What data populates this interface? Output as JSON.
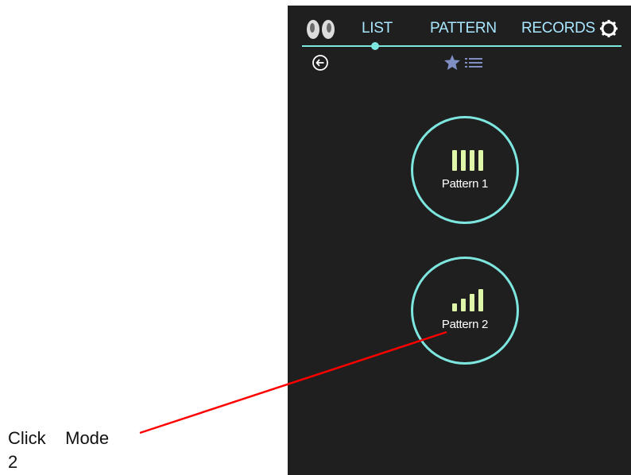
{
  "nav": {
    "tabs": [
      {
        "label": "LIST"
      },
      {
        "label": "PATTERN"
      },
      {
        "label": "RECORDS"
      }
    ],
    "active_tab": "LIST",
    "icons": {
      "logo": "feet-logo-icon",
      "settings": "gear-icon",
      "back": "back-arrow-icon",
      "favorites": "star-list-icon"
    }
  },
  "patterns": [
    {
      "label": "Pattern 1",
      "icon": "equal-bars-icon"
    },
    {
      "label": "Pattern 2",
      "icon": "ascending-bars-icon"
    }
  ],
  "annotation": {
    "text_line1": "Click    Mode",
    "text_line2": "2"
  },
  "colors": {
    "background": "#1f1f1f",
    "accent": "#7de6df",
    "tab_text": "#a9e7ff",
    "bars": "#dff7a8",
    "annotation_line": "#ff0000",
    "star": "#7f8fc4"
  }
}
